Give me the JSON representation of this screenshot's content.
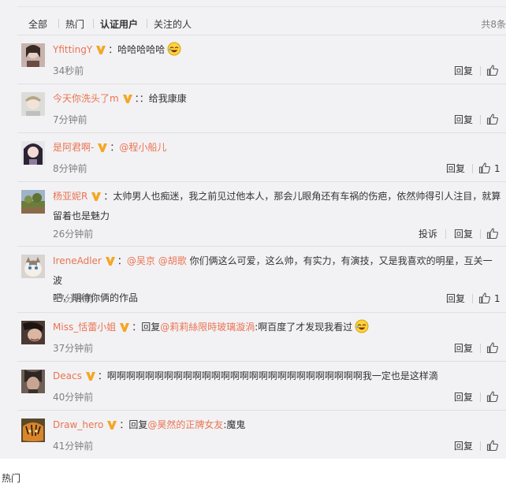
{
  "tabs": [
    "全部",
    "热门",
    "认证用户",
    "关注的人"
  ],
  "active_tab": "认证用户",
  "total_count": "共8条",
  "reply_label": "回复",
  "report_label": "投诉",
  "comments": [
    {
      "username": "YfittingY",
      "sep": "：",
      "text": "哈哈哈哈哈",
      "emoji": "laugh-emoji",
      "time": "34秒前",
      "like_count": ""
    },
    {
      "username": "今天你洗头了m",
      "sep": "：",
      "text": "：给我康康",
      "time": "7分钟前",
      "like_count": ""
    },
    {
      "username": "是阿君啊-",
      "sep": "：",
      "mention": "@程小船儿",
      "time": "8分钟前",
      "like_count": "1"
    },
    {
      "username": "杨亚妮R",
      "sep": "：",
      "text_line1": "太帅男人也痴迷，我之前见过他本人，那会儿眼角还有车祸的伤疤，依然帅得引人注目，就算",
      "text_line2": "留着也是魅力",
      "time": "26分钟前",
      "like_count": ""
    },
    {
      "username": "IreneAdler",
      "sep": "：",
      "mention1": "@吴京",
      "mention2": "@胡歌",
      "text_line1": "你们俩这么可爱，这么帅，有实力，有演技，又是我喜欢的明星，互关一波",
      "text_line2": "吧，期待你俩的作品",
      "time": "37分钟前",
      "like_count": "1"
    },
    {
      "username": "Miss_恬蕾小姐",
      "sep": "：",
      "reply_prefix": "回复",
      "mention": "@莉莉絲限時玻璃漩渦",
      "text": ":啊百度了才发现我看过",
      "emoji": "laugh-emoji",
      "time": "37分钟前",
      "like_count": ""
    },
    {
      "username": "Deacs",
      "sep": "：",
      "text": "啊啊啊啊啊啊啊啊啊啊啊啊啊啊啊啊啊啊啊啊啊啊啊啊啊啊啊我一定也是这样滴",
      "time": "40分钟前",
      "like_count": ""
    },
    {
      "username": "Draw_hero",
      "sep": "：",
      "reply_prefix": "回复",
      "mention": "@昊然的正牌女友",
      "text": ":魔鬼",
      "time": "41分钟前",
      "like_count": ""
    }
  ],
  "footer_label": "热门",
  "colors": {
    "accent": "#eb7350",
    "badge": "#f5a623",
    "muted": "#808080",
    "panel_bg": "#f2f2f5"
  }
}
